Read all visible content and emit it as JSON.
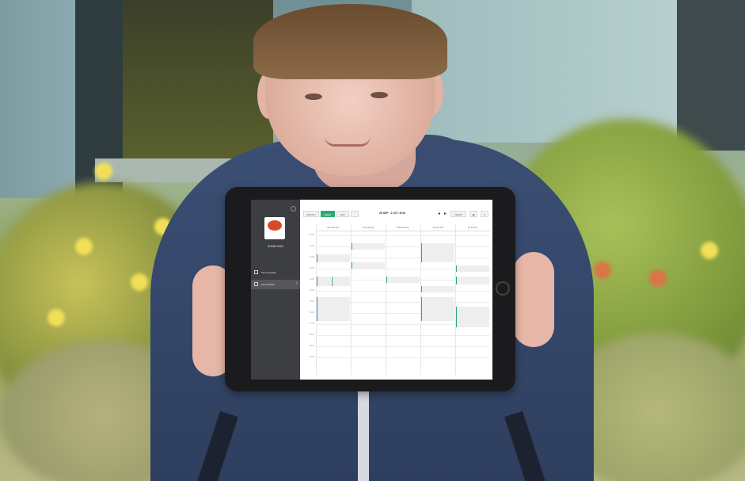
{
  "scene": {
    "background": "outdoor-bushes-and-building",
    "subject": "person-holding-tablet"
  },
  "app": {
    "user": {
      "name": "DUANE KING",
      "subtitle": ""
    },
    "logo_text": "",
    "sidebar": {
      "items": [
        {
          "label": "Find timetable",
          "icon": "square-icon"
        },
        {
          "label": "My timetable",
          "icon": "person-icon",
          "active": true
        }
      ]
    },
    "toolbar": {
      "views": [
        "MONTH",
        "WEEK",
        "DAY"
      ],
      "active_view": "WEEK",
      "date_range": "28 SEP - 2 OCT 2016",
      "today_label": "TODAY"
    },
    "calendar": {
      "days": [
        "Mon 28 Sep",
        "Tue 29 Sep",
        "Wed 30 Sep",
        "Thu 01 Oct",
        "Fri 02 Oct"
      ],
      "times": [
        "09:00",
        "10:00",
        "11:00",
        "12:00",
        "13:00",
        "14:00",
        "15:00",
        "16:00",
        "17:00",
        "18:00",
        "19:00",
        "20:00"
      ]
    },
    "colors": {
      "accent": "#2eaa76",
      "sidebar": "#3d3e41",
      "event_alt": "#3b8fd6"
    }
  }
}
